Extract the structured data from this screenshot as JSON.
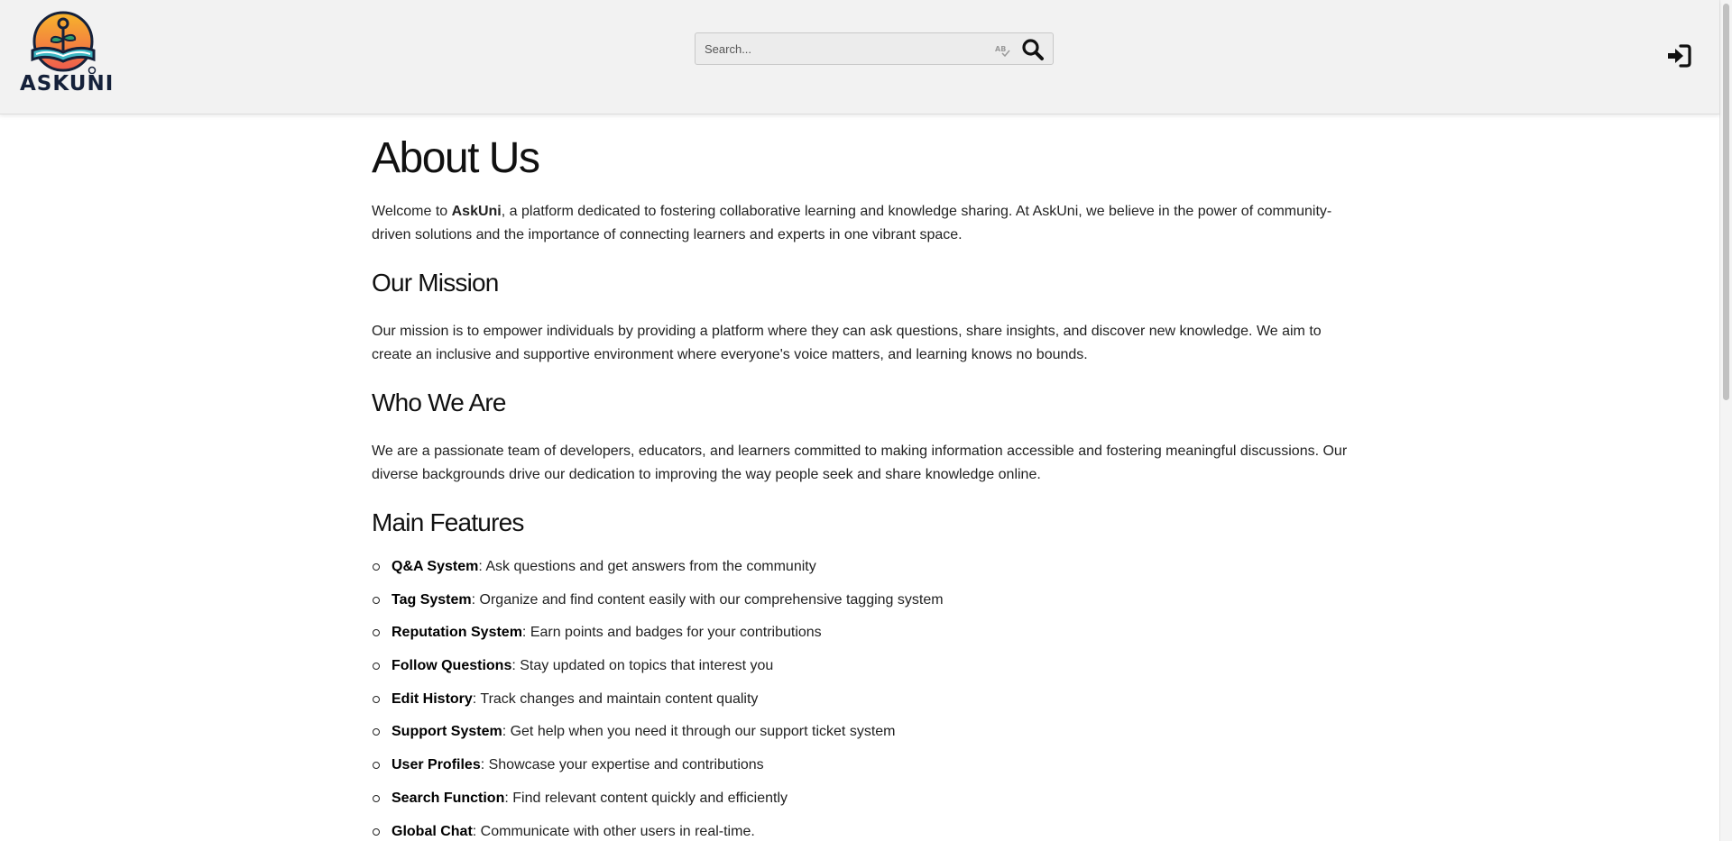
{
  "header": {
    "logo_text": "ASKUNI",
    "search_placeholder": "Search..."
  },
  "page": {
    "title": "About Us",
    "intro": {
      "prefix": "Welcome to ",
      "brand": "AskUni",
      "suffix": ", a platform dedicated to fostering collaborative learning and knowledge sharing. At AskUni, we believe in the power of community-driven solutions and the importance of connecting learners and experts in one vibrant space."
    },
    "sections": [
      {
        "heading": "Our Mission",
        "text": "Our mission is to empower individuals by providing a platform where they can ask questions, share insights, and discover new knowledge. We aim to create an inclusive and supportive environment where everyone's voice matters, and learning knows no bounds."
      },
      {
        "heading": "Who We Are",
        "text": "We are a passionate team of developers, educators, and learners committed to making information accessible and fostering meaningful discussions. Our diverse backgrounds drive our dedication to improving the way people seek and share knowledge online."
      }
    ],
    "features_heading": "Main Features",
    "features": [
      {
        "name": "Q&A System",
        "desc": ": Ask questions and get answers from the community"
      },
      {
        "name": "Tag System",
        "desc": ": Organize and find content easily with our comprehensive tagging system"
      },
      {
        "name": "Reputation System",
        "desc": ": Earn points and badges for your contributions"
      },
      {
        "name": "Follow Questions",
        "desc": ": Stay updated on topics that interest you"
      },
      {
        "name": "Edit History",
        "desc": ": Track changes and maintain content quality"
      },
      {
        "name": "Support System",
        "desc": ": Get help when you need it through our support ticket system"
      },
      {
        "name": "User Profiles",
        "desc": ": Showcase your expertise and contributions"
      },
      {
        "name": "Search Function",
        "desc": ": Find relevant content quickly and efficiently"
      },
      {
        "name": "Global Chat",
        "desc": ": Communicate with other users in real-time."
      }
    ]
  },
  "icons": {
    "logo": "askuni-logo",
    "spellcheck": "spellcheck-icon",
    "search": "search-icon",
    "login": "login-icon"
  },
  "colors": {
    "header_bg": "#f2f2f2",
    "logo_navy": "#15213a",
    "logo_orange": "#f5a623",
    "logo_red": "#ee5a4f",
    "logo_teal": "#3fb8c4",
    "logo_green": "#2e9e6e"
  }
}
